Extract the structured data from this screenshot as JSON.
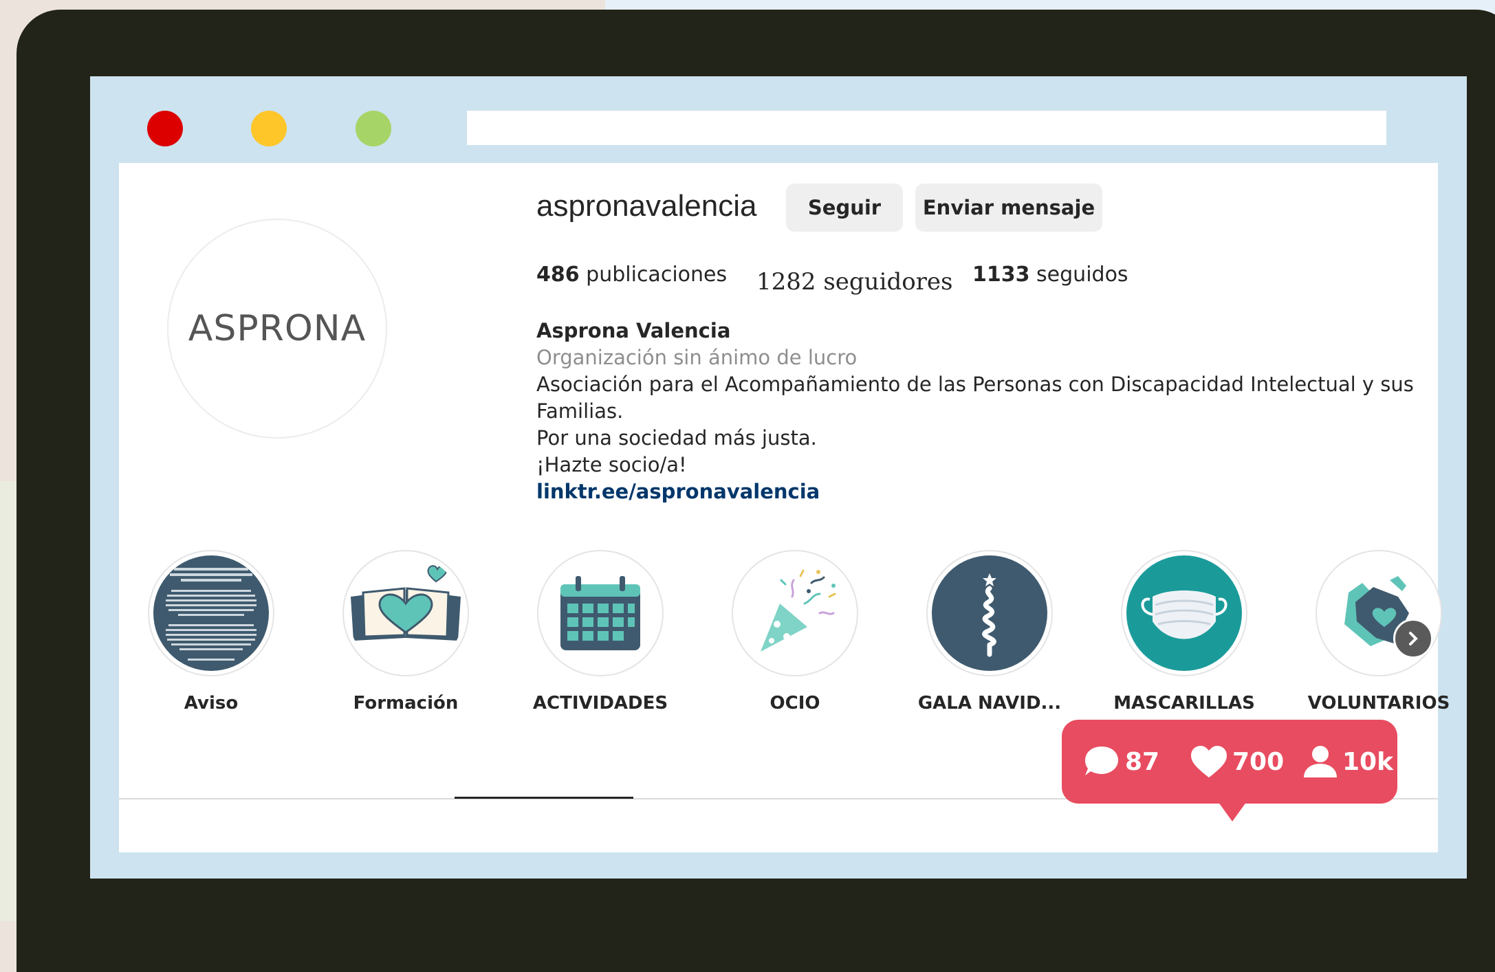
{
  "profile": {
    "avatar_text": "ASPRONA",
    "username": "aspronavalencia",
    "follow_label": "Seguir",
    "message_label": "Enviar mensaje",
    "posts_count": "486",
    "posts_label": "publicaciones",
    "followers_text": "1282 seguidores",
    "following_count": "1133",
    "following_label": "seguidos",
    "bio": {
      "name": "Asprona Valencia",
      "category": "Organización sin ánimo de lucro",
      "line1": "Asociación para el Acompañamiento de las Personas con Discapacidad Intelectual y sus Familias.",
      "line2": "Por una sociedad más justa.",
      "line3": "¡Hazte socio/a!",
      "link": "linktr.ee/aspronavalencia"
    }
  },
  "highlights": [
    {
      "label": "Aviso",
      "icon": "text-notice-icon"
    },
    {
      "label": "Formación",
      "icon": "book-heart-icon"
    },
    {
      "label": "ACTIVIDADES",
      "icon": "calendar-icon"
    },
    {
      "label": "OCIO",
      "icon": "party-popper-icon"
    },
    {
      "label": "GALA NAVID...",
      "icon": "christmas-tree-icon"
    },
    {
      "label": "MASCARILLAS",
      "icon": "face-mask-icon"
    },
    {
      "label": "VOLUNTARIOS",
      "icon": "hands-heart-icon"
    }
  ],
  "notification": {
    "comments": "87",
    "likes": "700",
    "followers": "10k"
  },
  "colors": {
    "accent": "#e84c60",
    "teal": "#5fc4b8",
    "slate": "#3f5a6e",
    "laptop": "#232419",
    "screen": "#cde3ef"
  }
}
